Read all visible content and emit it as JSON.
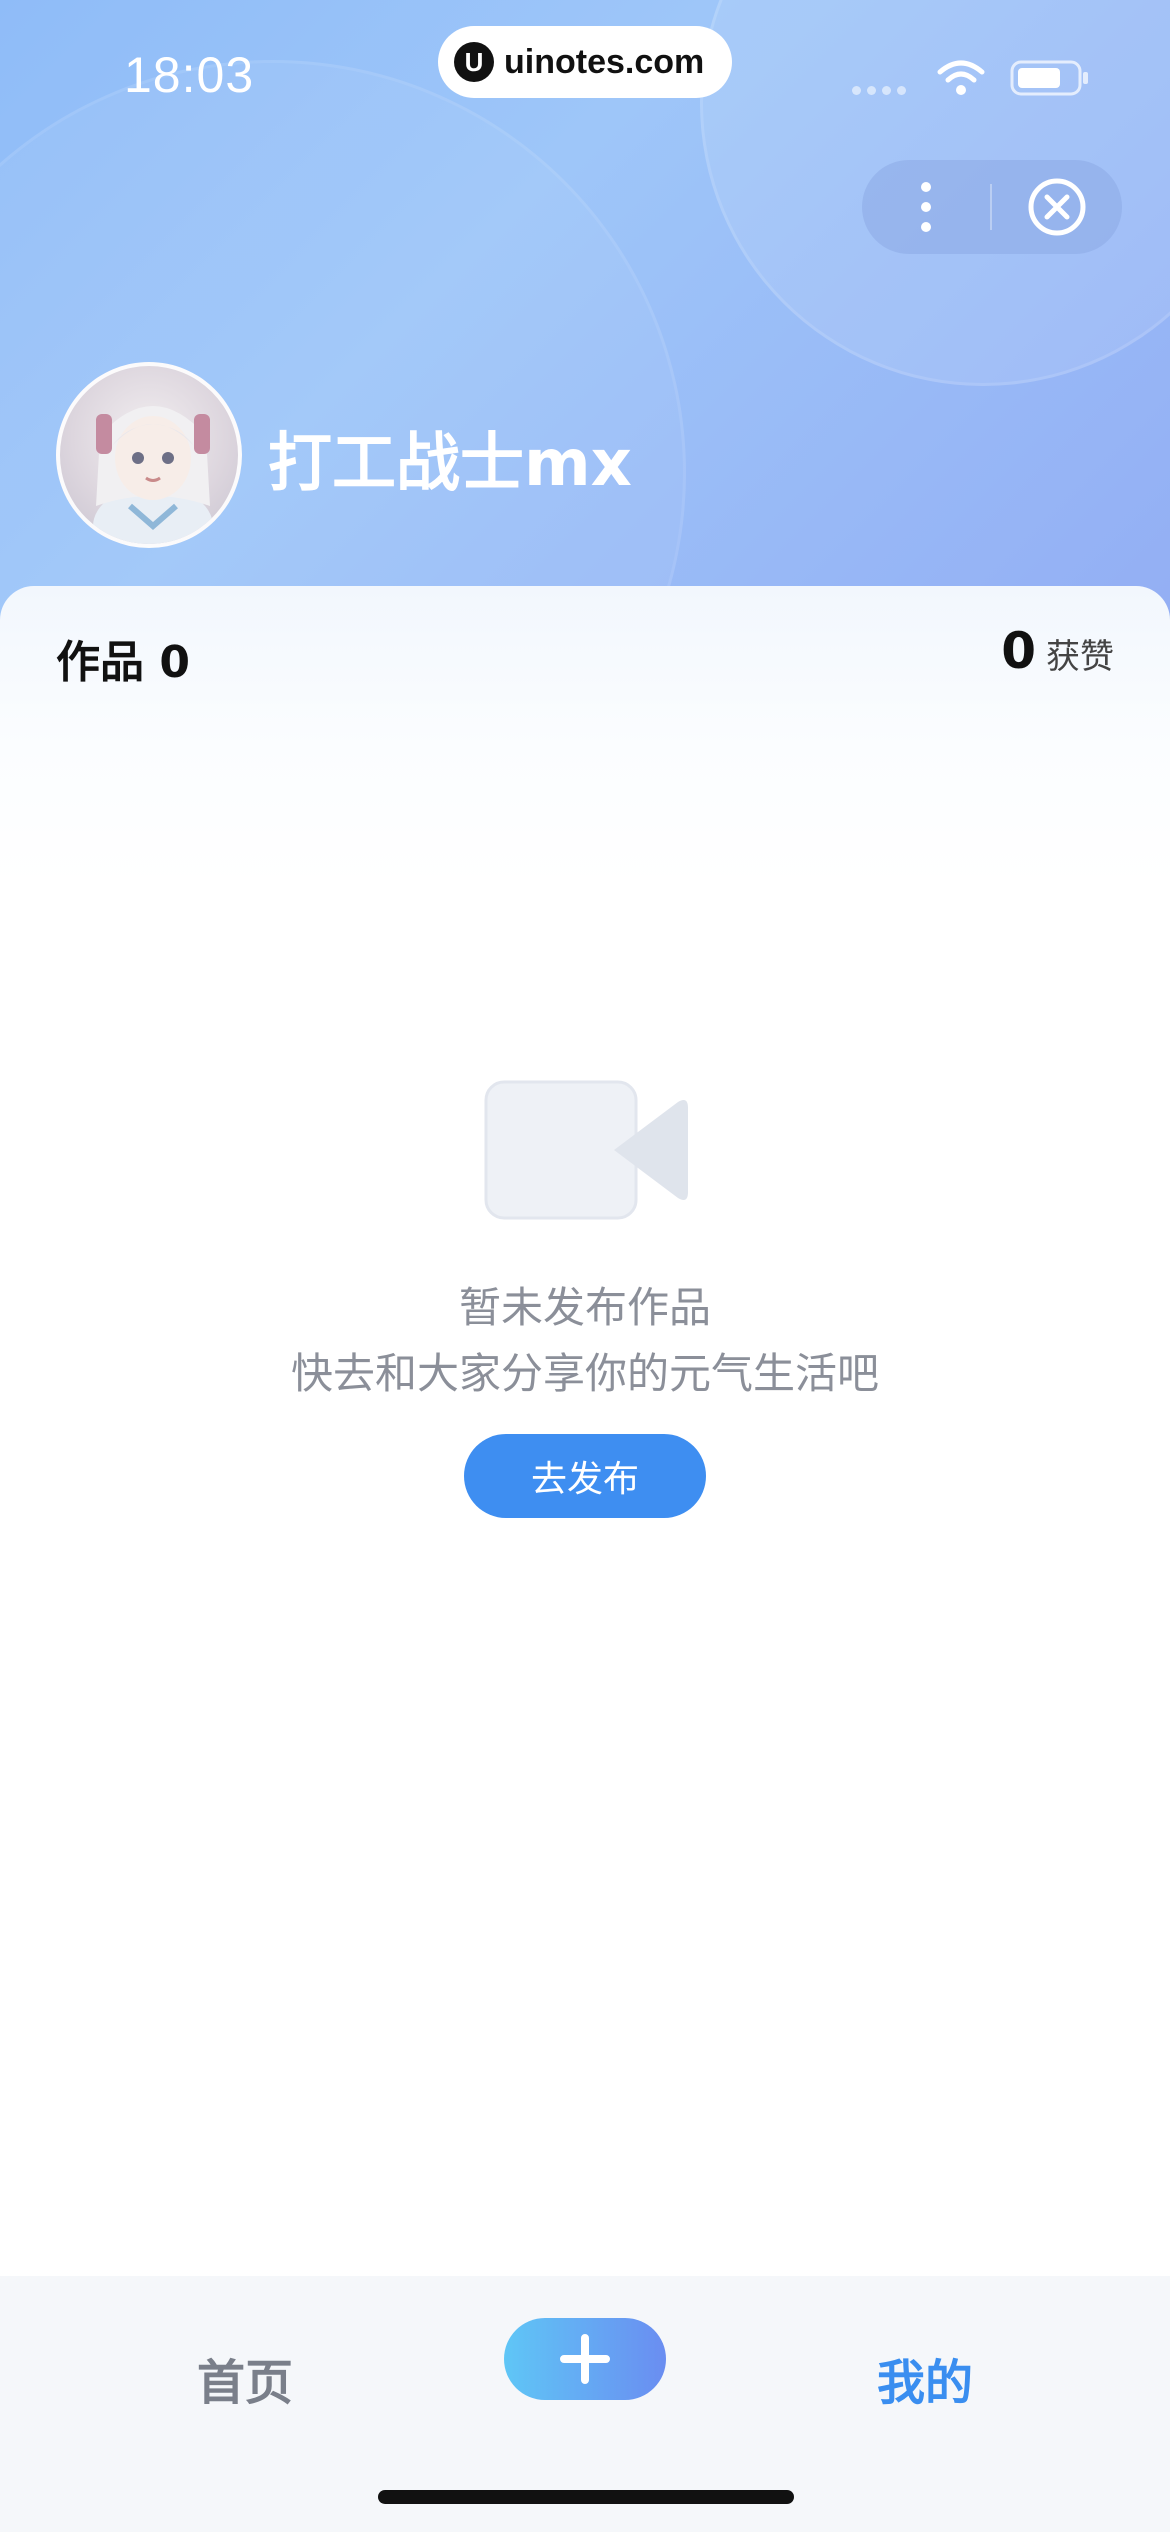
{
  "status_bar": {
    "time": "18:03",
    "url": "uinotes.com",
    "url_logo": "U"
  },
  "capsule": {
    "more_icon": "more-vertical-icon",
    "close_icon": "close-circle-icon"
  },
  "profile": {
    "username": "打工战士mx"
  },
  "stats": {
    "works_label": "作品 0",
    "likes_count": "0",
    "likes_label": "获赞"
  },
  "empty_state": {
    "icon": "video-camera-icon",
    "title": "暂未发布作品",
    "subtitle": "快去和大家分享你的元气生活吧",
    "button_label": "去发布"
  },
  "tabbar": {
    "home_label": "首页",
    "add_icon": "plus-icon",
    "mine_label": "我的"
  },
  "colors": {
    "accent": "#3e8ef1",
    "active_tab": "#3a8ef0",
    "inactive_tab": "#7a7f8a",
    "muted_text": "#8b8f99"
  }
}
